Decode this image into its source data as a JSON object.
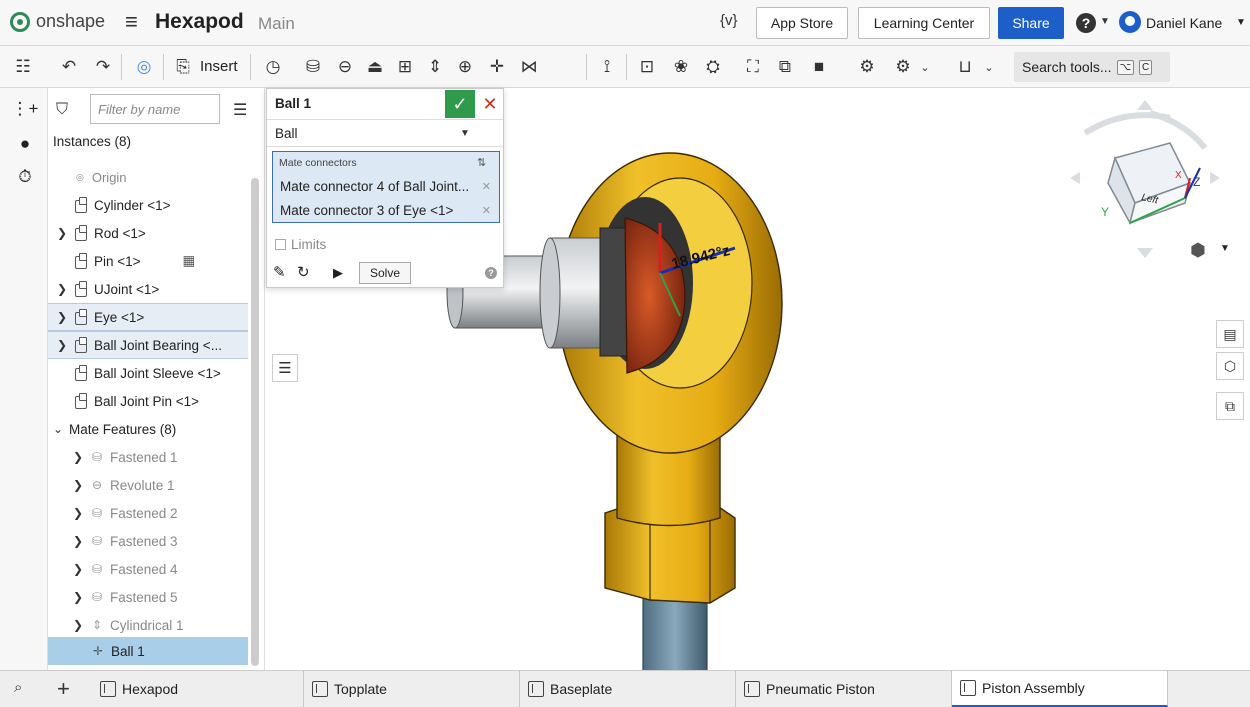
{
  "topbar": {
    "logo": "onshape",
    "document_title": "Hexapod",
    "branch": "Main",
    "variable_icon": "{v}",
    "app_store": "App Store",
    "learning_center": "Learning Center",
    "share": "Share",
    "user_name": "Daniel Kane"
  },
  "toolbar": {
    "insert_label": "Insert",
    "search_tools": "Search tools...",
    "search_shortcut_1": "⌥",
    "search_shortcut_2": "C"
  },
  "panel": {
    "filter_placeholder": "Filter by name",
    "instances_header": "Instances (8)",
    "instances": [
      {
        "label": "Origin",
        "type": "origin"
      },
      {
        "label": "Cylinder <1>",
        "type": "part"
      },
      {
        "label": "Rod <1>",
        "type": "part",
        "expandable": true
      },
      {
        "label": "Pin <1>",
        "type": "part"
      },
      {
        "label": "UJoint <1>",
        "type": "part",
        "expandable": true
      },
      {
        "label": "Eye <1>",
        "type": "part",
        "expandable": true
      },
      {
        "label": "Ball Joint Bearing <...",
        "type": "part",
        "expandable": true
      },
      {
        "label": "Ball Joint Sleeve <1>",
        "type": "part"
      },
      {
        "label": "Ball Joint Pin <1>",
        "type": "part"
      }
    ],
    "mate_header": "Mate Features (8)",
    "mates": [
      {
        "label": "Fastened 1"
      },
      {
        "label": "Revolute 1"
      },
      {
        "label": "Fastened 2"
      },
      {
        "label": "Fastened 3"
      },
      {
        "label": "Fastened 4"
      },
      {
        "label": "Fastened 5"
      },
      {
        "label": "Cylindrical 1"
      },
      {
        "label": "Ball 1"
      }
    ]
  },
  "mate_dialog": {
    "title": "Ball 1",
    "type": "Ball",
    "connectors_header": "Mate connectors",
    "connectors": [
      "Mate connector 4 of Ball Joint...",
      "Mate connector 3 of Eye <1>"
    ],
    "limits": "Limits",
    "solve": "Solve"
  },
  "viewport": {
    "angle_label": "18.942°z",
    "view_cube_face": "Left",
    "axis_x": "X",
    "axis_y": "Y",
    "axis_z": "Z"
  },
  "tabs": [
    {
      "label": "Hexapod",
      "active": false
    },
    {
      "label": "Topplate",
      "active": false
    },
    {
      "label": "Baseplate",
      "active": false
    },
    {
      "label": "Pneumatic Piston",
      "active": false
    },
    {
      "label": "Piston Assembly",
      "active": true
    }
  ],
  "colors": {
    "accent_blue": "#1d5ec9",
    "ok_green": "#2e9a4a",
    "cancel_red": "#d62d20",
    "part_gold": "#e6b21c",
    "selection_blue": "#a9cfe8"
  }
}
